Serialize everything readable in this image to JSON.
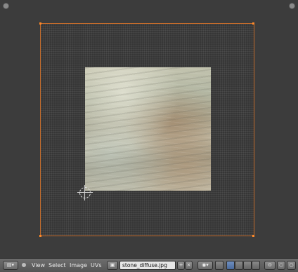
{
  "menus": {
    "view": "View",
    "select": "Select",
    "image": "Image",
    "uvs": "UVs"
  },
  "image_browser": {
    "filename": "stone_diffuse.jpg"
  },
  "colors": {
    "uv_edge": "#c46c2c",
    "vertex": "#ff8a2a",
    "header": "#5e5e5e"
  },
  "icons": [
    "editor-type-icon",
    "image-browse-icon",
    "add-icon",
    "unlink-icon",
    "pivot-icon",
    "sync-icon",
    "vertex-select-icon",
    "edge-select-icon",
    "face-select-icon",
    "island-select-icon",
    "snap-icon",
    "proportional-icon"
  ]
}
